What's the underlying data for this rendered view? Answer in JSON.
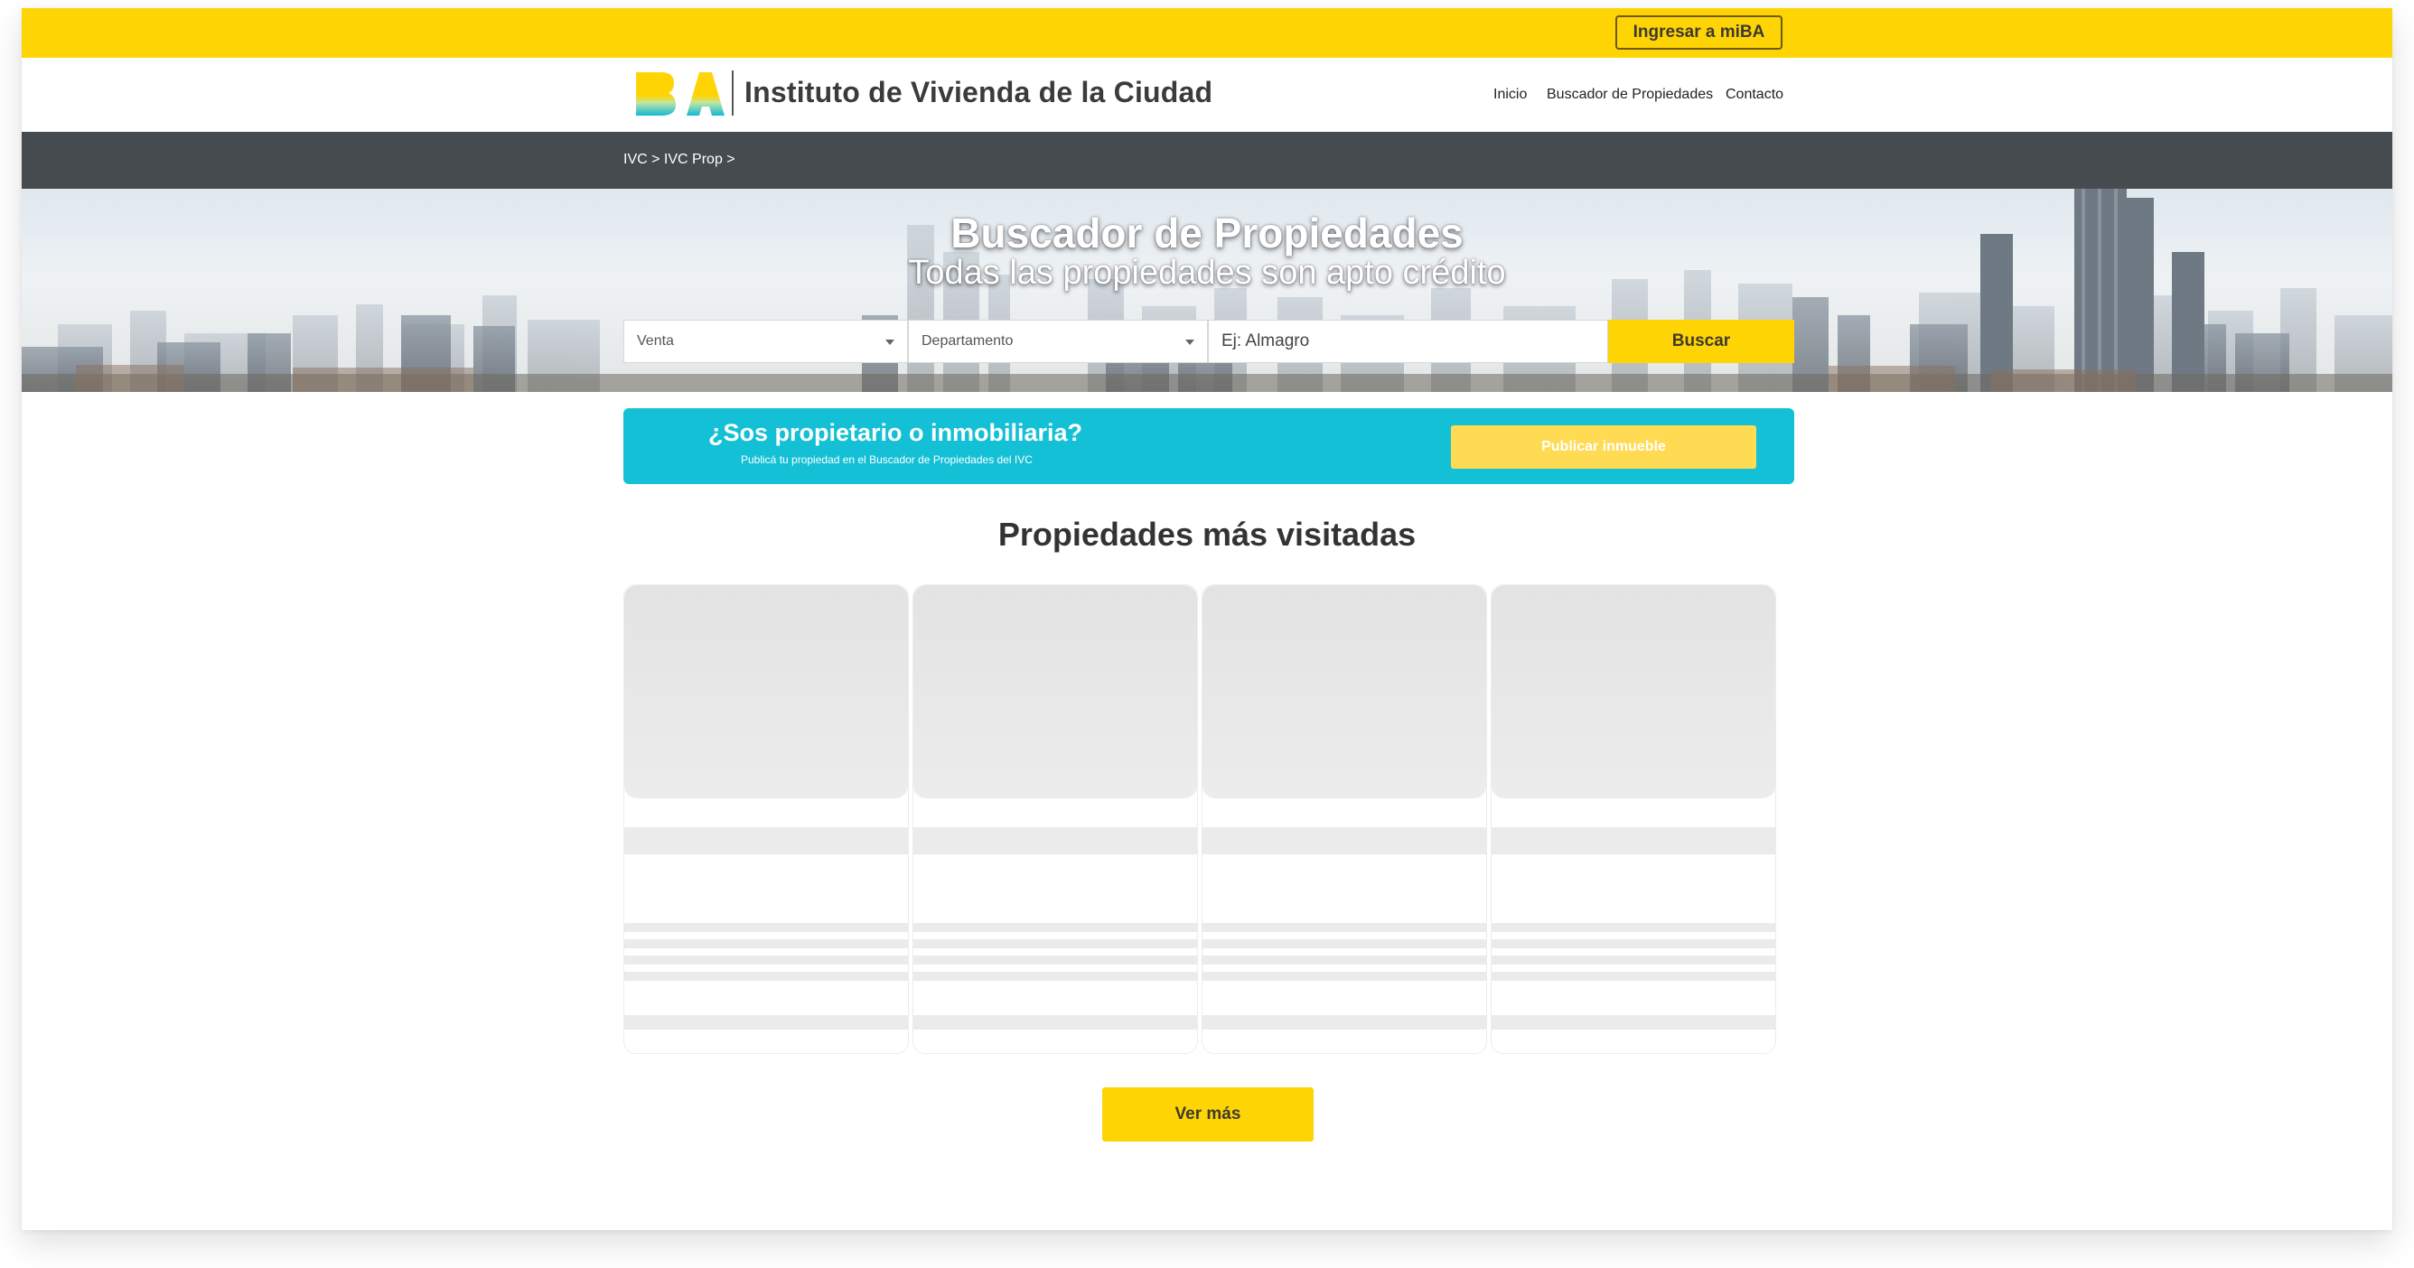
{
  "topbar": {
    "login_label": "Ingresar a miBA"
  },
  "header": {
    "logo_text": "BA",
    "site_title": "Instituto de Vivienda de la Ciudad",
    "nav": [
      "Inicio",
      "Buscador de Propiedades",
      "Contacto"
    ]
  },
  "breadcrumb": {
    "items": [
      "IVC",
      "IVC Prop"
    ],
    "separator": ">"
  },
  "hero": {
    "title": "Buscador de Propiedades",
    "subtitle": "Todas las propiedades son apto crédito"
  },
  "search": {
    "operation": "Venta",
    "type": "Departamento",
    "placeholder": "Ej: Almagro",
    "button_label": "Buscar"
  },
  "promo": {
    "title": "¿Sos propietario o inmobiliaria?",
    "subtitle": "Publicá tu propiedad en el Buscador de Propiedades del IVC",
    "button_label": "Publicar inmueble"
  },
  "section_title": "Propiedades más visitadas",
  "more_label": "Ver más",
  "colors": {
    "brand_yellow": "#ffd404",
    "header_dark": "#464b4f",
    "promo_cyan": "#14c0d6",
    "promo_button": "#ffdb54"
  },
  "icons": [
    "ba-logo",
    "chevron-down-icon"
  ]
}
